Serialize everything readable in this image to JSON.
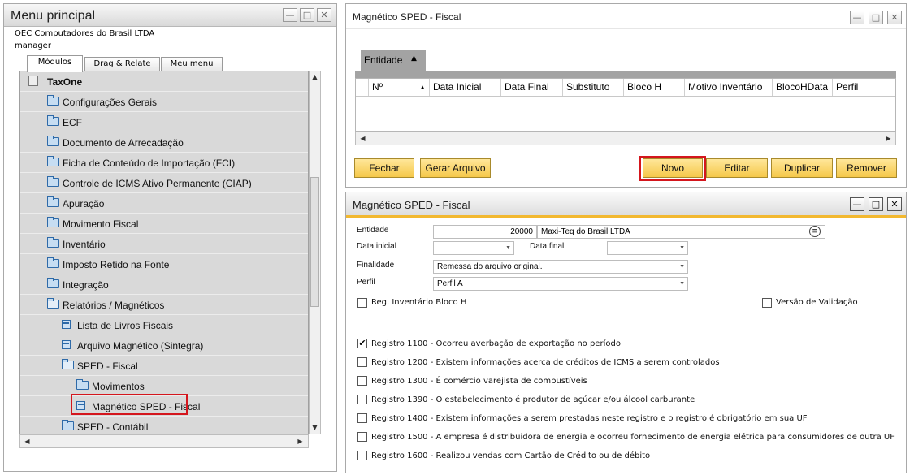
{
  "menu": {
    "title": "Menu principal",
    "company": "OEC Computadores do Brasil LTDA",
    "user": "manager",
    "tabs": [
      "Módulos",
      "Drag & Relate",
      "Meu menu"
    ],
    "items": [
      {
        "label": "TaxOne",
        "icon": "calculator-icon"
      },
      {
        "label": "Configurações Gerais",
        "icon": "folder-icon"
      },
      {
        "label": "ECF",
        "icon": "folder-icon"
      },
      {
        "label": "Documento de Arrecadação",
        "icon": "folder-icon"
      },
      {
        "label": "Ficha de Conteúdo de Importação (FCI)",
        "icon": "folder-icon"
      },
      {
        "label": "Controle de ICMS Ativo Permanente (CIAP)",
        "icon": "folder-icon"
      },
      {
        "label": "Apuração",
        "icon": "folder-icon"
      },
      {
        "label": "Movimento Fiscal",
        "icon": "folder-icon"
      },
      {
        "label": "Inventário",
        "icon": "folder-icon"
      },
      {
        "label": "Imposto Retido na Fonte",
        "icon": "folder-icon"
      },
      {
        "label": "Integração",
        "icon": "folder-icon"
      },
      {
        "label": "Relatórios / Magnéticos",
        "icon": "folder-open-icon"
      },
      {
        "label": "Lista de Livros Fiscais",
        "icon": "document-icon"
      },
      {
        "label": "Arquivo Magnético (Sintegra)",
        "icon": "document-icon"
      },
      {
        "label": "SPED - Fiscal",
        "icon": "folder-open-icon"
      },
      {
        "label": "Movimentos",
        "icon": "folder-icon"
      },
      {
        "label": "Magnético SPED - Fiscal",
        "icon": "document-icon"
      },
      {
        "label": "SPED - Contábil",
        "icon": "folder-icon"
      }
    ]
  },
  "list_window": {
    "title": "Magnético SPED - Fiscal",
    "group_header": "Entidade",
    "columns": [
      "Nº",
      "Data Inicial",
      "Data Final",
      "Substituto",
      "Bloco H",
      "Motivo Inventário",
      "BlocoHData",
      "Perfil"
    ],
    "buttons": {
      "close": "Fechar",
      "generate": "Gerar Arquivo",
      "new": "Novo",
      "edit": "Editar",
      "duplicate": "Duplicar",
      "remove": "Remover"
    }
  },
  "form_window": {
    "title": "Magnético SPED - Fiscal",
    "entidade_label": "Entidade",
    "entidade_code": "20000",
    "entidade_name": "Maxi-Teq do Brasil LTDA",
    "data_inicial_label": "Data inicial",
    "data_inicial_value": "",
    "data_final_label": "Data final",
    "data_final_value": "",
    "finalidade_label": "Finalidade",
    "finalidade_value": "Remessa do arquivo original.",
    "perfil_label": "Perfil",
    "perfil_value": "Perfil A",
    "reg_inventario_label": "Reg. Inventário Bloco H",
    "versao_validacao_label": "Versão de Validação",
    "registros": [
      {
        "text": "Registro 1100 - Ocorreu averbação de exportação no período",
        "checked": true
      },
      {
        "text": "Registro 1200 - Existem informações acerca de créditos de ICMS a serem controlados",
        "checked": false
      },
      {
        "text": "Registro 1300 - É comércio varejista de combustíveis",
        "checked": false
      },
      {
        "text": "Registro 1390 - O estabelecimento é produtor de açúcar e/ou álcool carburante",
        "checked": false
      },
      {
        "text": "Registro 1400 - Existem informações a serem prestadas neste registro e o registro é obrigatório em sua UF",
        "checked": false
      },
      {
        "text": "Registro 1500 - A empresa é distribuidora de energia e ocorreu fornecimento de energia elétrica para consumidores de outra UF",
        "checked": false
      },
      {
        "text": "Registro 1600 - Realizou vendas com Cartão de Crédito ou de débito",
        "checked": false
      }
    ]
  }
}
